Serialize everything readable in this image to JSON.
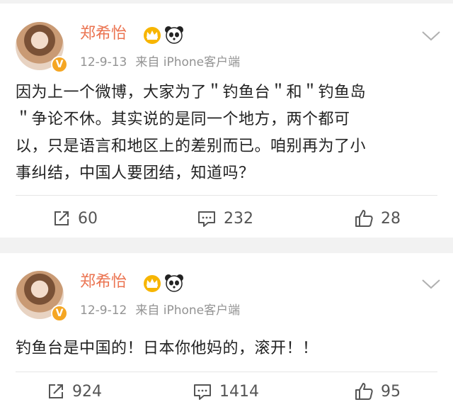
{
  "posts": [
    {
      "author": "郑希怡",
      "verified_badge": "V",
      "date": "12-9-13",
      "source": "来自 iPhone客户端",
      "text": "因为上一个微博，大家为了＂钓鱼台＂和＂钓鱼岛＂争论不休。其实说的是同一个地方，两个都可以，只是语言和地区上的差别而已。咱别再为了小事纠结，中国人要团结，知道吗？",
      "text_lines": [
        "因为上一个微博，大家为了＂钓鱼台＂和＂钓鱼岛",
        "＂争论不休。其实说的是同一个地方，两个都可",
        "以，只是语言和地区上的差别而已。咱别再为了小",
        "事纠结，中国人要团结，知道吗？"
      ],
      "reposts": "60",
      "comments": "232",
      "likes": "28"
    },
    {
      "author": "郑希怡",
      "verified_badge": "V",
      "date": "12-9-12",
      "source": "来自 iPhone客户端",
      "text_lines": [
        "钓鱼台是中国的！日本你他妈的，滚开！！"
      ],
      "reposts": "924",
      "comments": "1414",
      "likes": "95"
    }
  ],
  "colors": {
    "name": "#eb7350",
    "meta": "#939393",
    "badge": "#f5a623",
    "background": "#f2f2f2"
  },
  "icons": {
    "badge": "crown-icon",
    "emoji": "panda-icon",
    "menu": "chevron-down-icon",
    "repost": "repost-icon",
    "comment": "comment-icon",
    "like": "thumbs-up-icon"
  }
}
